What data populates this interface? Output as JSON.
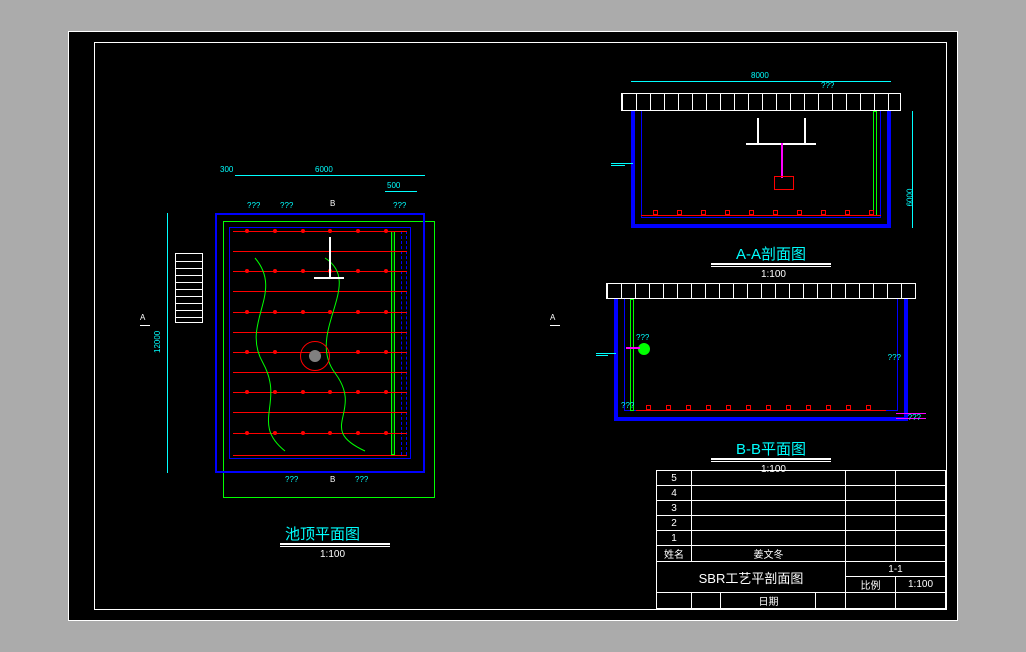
{
  "drawing": {
    "title_plan": "池顶平面图",
    "scale_plan": "1:100",
    "title_secA": "A-A剖面图",
    "scale_secA": "1:100",
    "title_secB": "B-B平面图",
    "scale_secB": "1:100"
  },
  "dimensions": {
    "plan_left_height": "12000",
    "plan_top_width": "6000",
    "plan_top_off": "300",
    "plan_top_gap": "500",
    "secA_width": "8000",
    "secA_height": "6000",
    "secA_top_small": "???"
  },
  "callouts": {
    "q": "???"
  },
  "section_marks": {
    "A": "A",
    "B": "B"
  },
  "titleblock": {
    "rows": [
      "5",
      "4",
      "3",
      "2",
      "1"
    ],
    "name_label": "姓名",
    "name_value": "姜文冬",
    "sheet_name": "SBR工艺平剖面图",
    "sheet_no": "1-1",
    "scale_label": "比例",
    "scale_value": "1:100",
    "date_label": "日期"
  }
}
